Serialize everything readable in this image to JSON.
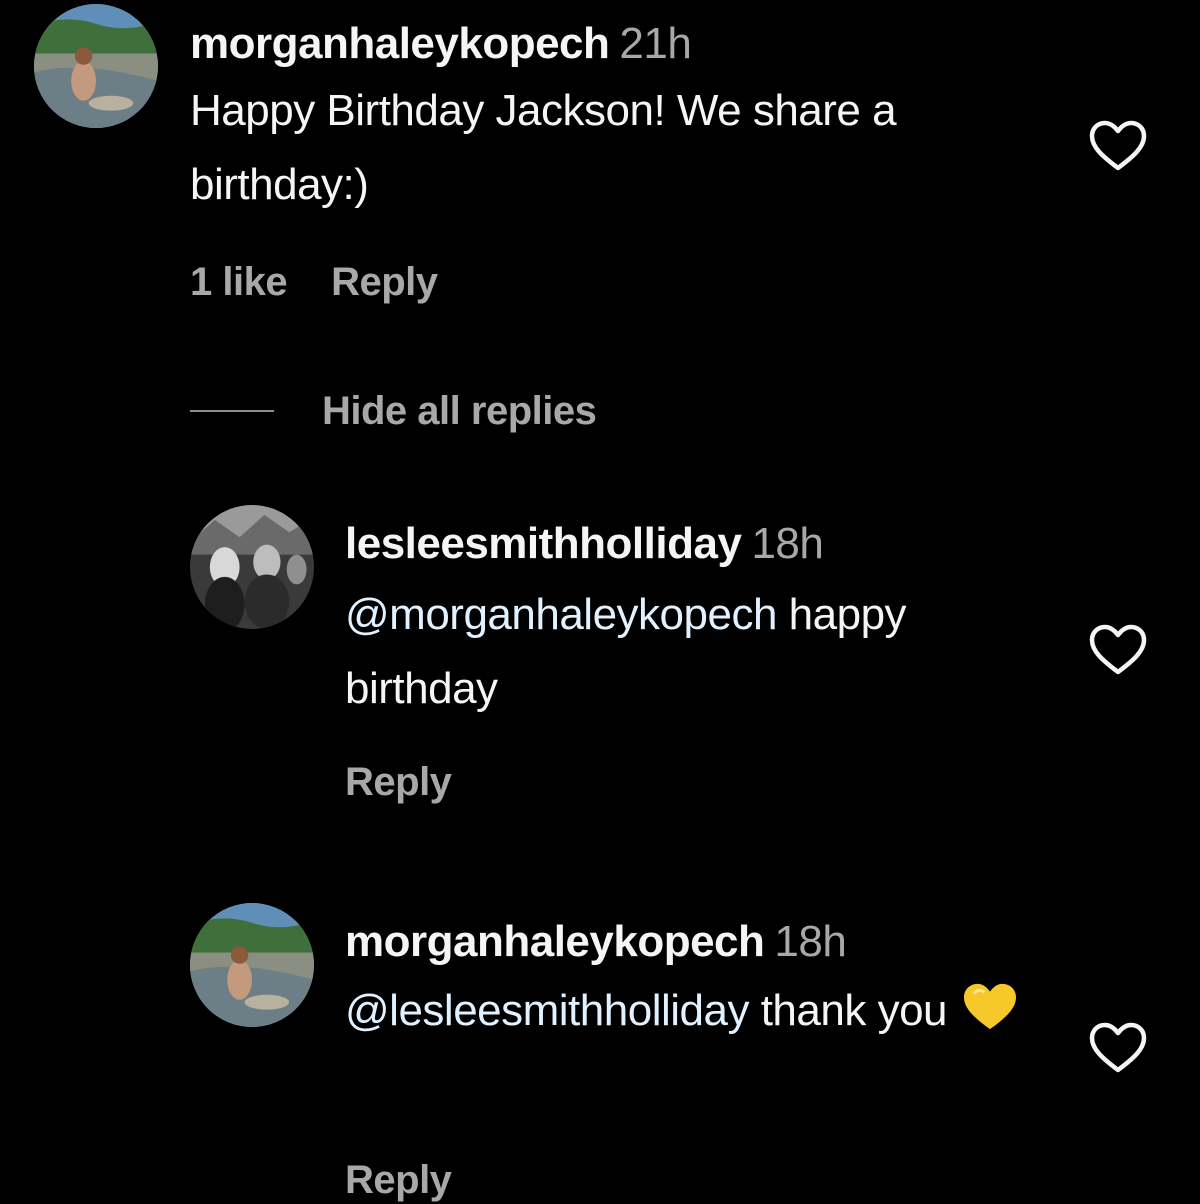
{
  "comments": [
    {
      "username": "morganhaleykopech",
      "time": "21h",
      "text": "Happy Birthday Jackson! We share a birthday:)",
      "likes": "1 like",
      "reply_label": "Reply"
    }
  ],
  "replies_toggle": {
    "label": "Hide all replies"
  },
  "replies": [
    {
      "username": "lesleesmithholliday",
      "time": "18h",
      "mention": "@morganhaleykopech",
      "text": "happy birthday",
      "reply_label": "Reply"
    },
    {
      "username": "morganhaleykopech",
      "time": "18h",
      "mention": "@lesleesmithholliday",
      "text": "thank you",
      "emoji": "yellow-heart",
      "reply_label": "Reply"
    }
  ],
  "colors": {
    "background": "#000000",
    "text": "#f5f5f5",
    "secondary": "#a8a8a8",
    "mention": "#e0f1ff",
    "emoji_heart": "#f7c82a"
  },
  "icons": {
    "like": "heart-outline-icon",
    "emoji": "yellow-heart-icon"
  }
}
